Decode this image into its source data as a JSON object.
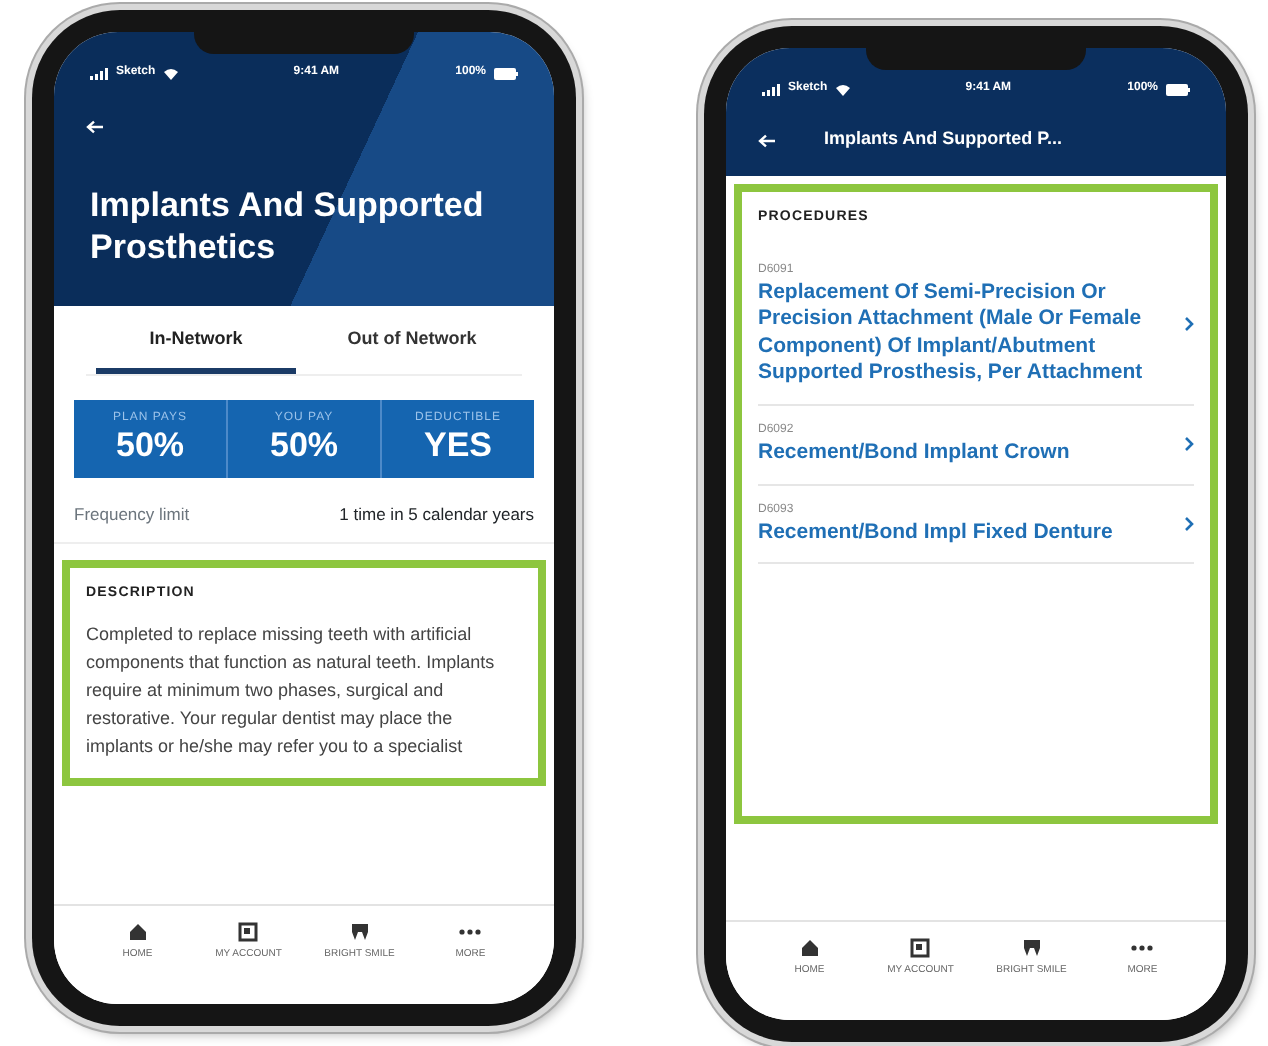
{
  "phones": [
    {
      "kind": "detail",
      "status_bar": {
        "carrier": "Sketch",
        "time": "9:41 AM",
        "battery": "100%"
      },
      "title": "Implants And Supported Prosthetics",
      "tabs": [
        {
          "label": "In-Network",
          "selected": true
        },
        {
          "label": "Out of Network",
          "selected": false
        }
      ],
      "stats": [
        {
          "label": "PLAN PAYS",
          "value": "50%"
        },
        {
          "label": "YOU PAY",
          "value": "50%"
        },
        {
          "label": "DEDUCTIBLE",
          "value": "YES"
        }
      ],
      "frequency": {
        "label": "Frequency limit",
        "value": "1 time in 5 calendar years"
      },
      "description": {
        "heading": "DESCRIPTION",
        "text": "Completed to replace missing teeth with artificial components that function as natural teeth. Implants require at minimum two phases, surgical and restorative. Your regular dentist may place the implants or he/she may refer you to a specialist"
      },
      "nav": [
        {
          "label": "HOME",
          "kind": "home"
        },
        {
          "label": "MY ACCOUNT",
          "kind": "account"
        },
        {
          "label": "BRIGHT SMILE",
          "kind": "smile"
        },
        {
          "label": "MORE",
          "kind": "more"
        }
      ]
    },
    {
      "kind": "list",
      "status_bar": {
        "carrier": "Sketch",
        "time": "9:41 AM",
        "battery": "100%"
      },
      "title": "Implants And Supported P...",
      "procedures": {
        "heading": "PROCEDURES",
        "items": [
          {
            "code": "D6091",
            "name": "Replacement Of Semi-Precision Or Precision Attachment (Male Or Female Component) Of Implant/Abutment Supported Prosthesis, Per Attachment"
          },
          {
            "code": "D6092",
            "name": "Recement/Bond Implant Crown"
          },
          {
            "code": "D6093",
            "name": "Recement/Bond Impl Fixed Denture"
          }
        ]
      },
      "nav": [
        {
          "label": "HOME",
          "kind": "home"
        },
        {
          "label": "MY ACCOUNT",
          "kind": "account"
        },
        {
          "label": "BRIGHT SMILE",
          "kind": "smile"
        },
        {
          "label": "MORE",
          "kind": "more"
        }
      ]
    }
  ]
}
